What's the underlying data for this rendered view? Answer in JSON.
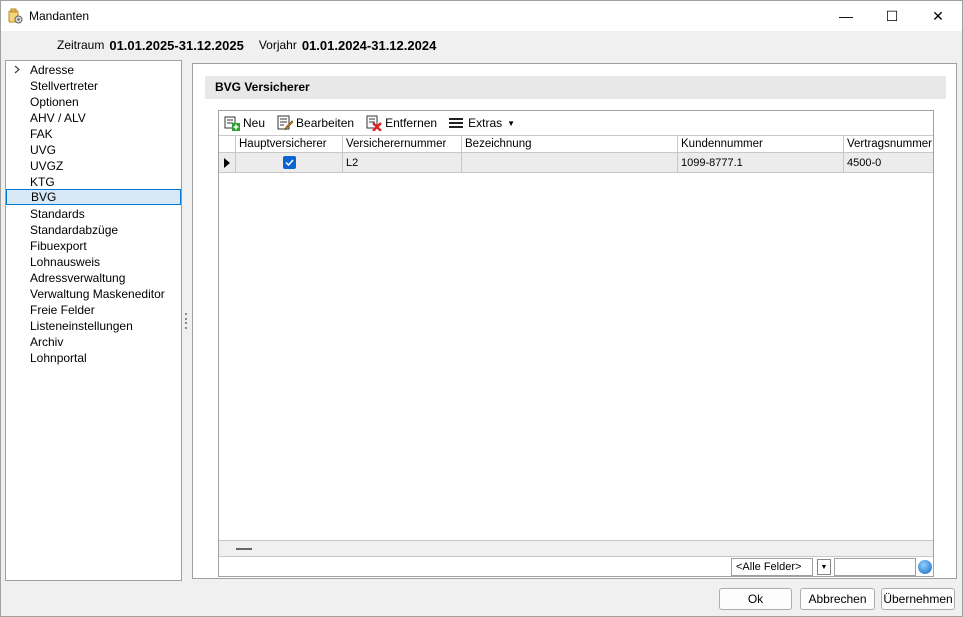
{
  "window": {
    "title": "Mandanten",
    "controls": {
      "minimize": "—",
      "maximize": "☐",
      "close": "✕"
    }
  },
  "header": {
    "period_label": "Zeitraum",
    "period_value": "01.01.2025-31.12.2025",
    "prior_label": "Vorjahr",
    "prior_value": "01.01.2024-31.12.2024"
  },
  "sidebar": {
    "items": [
      {
        "label": "Adresse"
      },
      {
        "label": "Stellvertreter"
      },
      {
        "label": "Optionen"
      },
      {
        "label": "AHV / ALV"
      },
      {
        "label": "FAK"
      },
      {
        "label": "UVG"
      },
      {
        "label": "UVGZ"
      },
      {
        "label": "KTG"
      },
      {
        "label": "BVG"
      },
      {
        "label": "Standards"
      },
      {
        "label": "Standardabzüge"
      },
      {
        "label": "Fibuexport"
      },
      {
        "label": "Lohnausweis"
      },
      {
        "label": "Adressverwaltung"
      },
      {
        "label": "Verwaltung Maskeneditor"
      },
      {
        "label": "Freie Felder"
      },
      {
        "label": "Listeneinstellungen"
      },
      {
        "label": "Archiv"
      },
      {
        "label": "Lohnportal"
      }
    ],
    "selected_index": 8
  },
  "panel": {
    "title": "BVG Versicherer",
    "toolbar": {
      "new_label": "Neu",
      "edit_label": "Bearbeiten",
      "remove_label": "Entfernen",
      "extras_label": "Extras"
    },
    "grid": {
      "columns": [
        "Hauptversicherer",
        "Versicherernummer",
        "Bezeichnung",
        "Kundennummer",
        "Vertragsnummer"
      ],
      "rows": [
        {
          "main_insurer": true,
          "insurer_number": "L2",
          "description": "",
          "customer_number": "1099-8777.1",
          "contract_number": "4500-0"
        }
      ]
    },
    "filter": {
      "field_value": "<Alle Felder>",
      "search_value": ""
    }
  },
  "buttons": {
    "ok": "Ok",
    "cancel": "Abbrechen",
    "apply": "Übernehmen"
  },
  "colors": {
    "selection_border": "#0078d7",
    "selection_fill": "#d9e8f7",
    "checkbox": "#0a64d2",
    "remove_icon": "#e02020",
    "new_icon": "#2e9e2e"
  }
}
